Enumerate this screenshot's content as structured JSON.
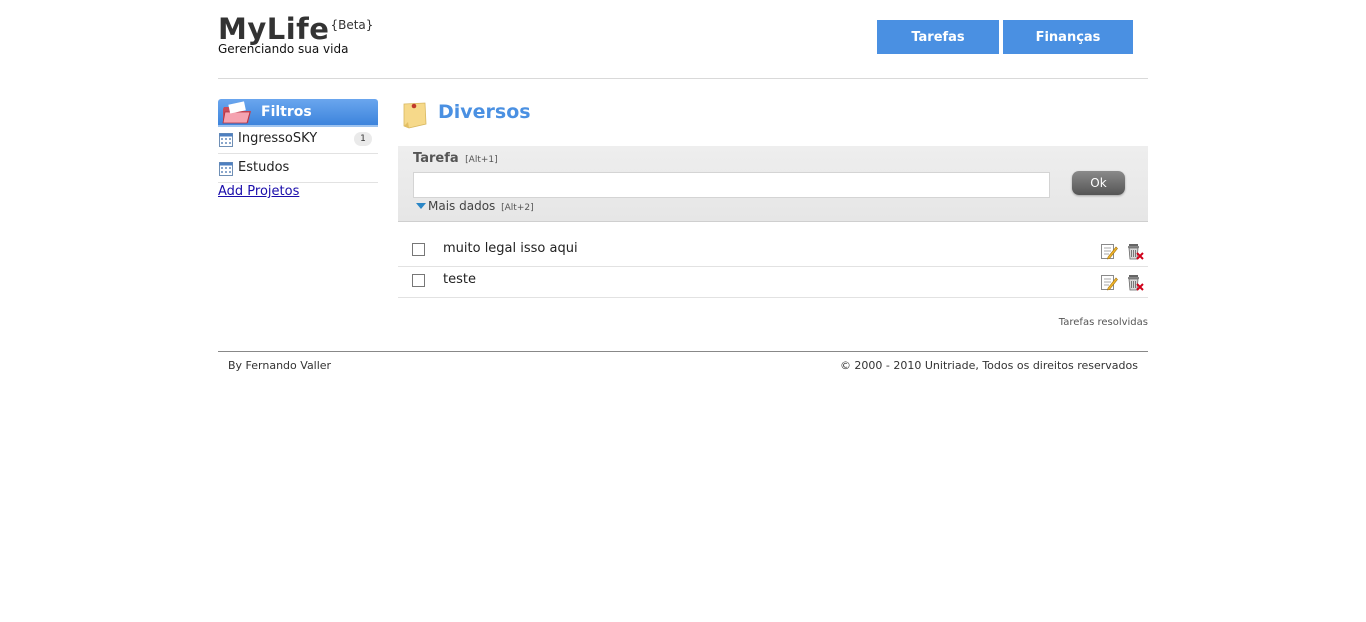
{
  "header": {
    "title": "MyLife",
    "beta": "{Beta}",
    "subtitle": "Gerenciando sua vida",
    "nav": {
      "tarefas": "Tarefas",
      "financas": "Finanças"
    }
  },
  "sidebar": {
    "title": "Filtros",
    "projects": [
      {
        "name": "IngressoSKY",
        "count": "1"
      },
      {
        "name": "Estudos",
        "count": ""
      }
    ],
    "add_label": "Add Projetos"
  },
  "main": {
    "title": "Diversos",
    "form": {
      "label": "Tarefa",
      "label_hint": "[Alt+1]",
      "input_value": "",
      "ok_label": "Ok",
      "mais_label": "Mais dados",
      "mais_hint": "[Alt+2]"
    },
    "tasks": [
      {
        "text": "muito legal isso aqui"
      },
      {
        "text": "teste"
      }
    ],
    "resolvidas": "Tarefas resolvidas"
  },
  "footer": {
    "by": "By Fernando Valler",
    "copyright": "© 2000 - 2010 Unitriade, Todos os direitos reservados"
  },
  "colors": {
    "accent": "#4a90e2"
  }
}
